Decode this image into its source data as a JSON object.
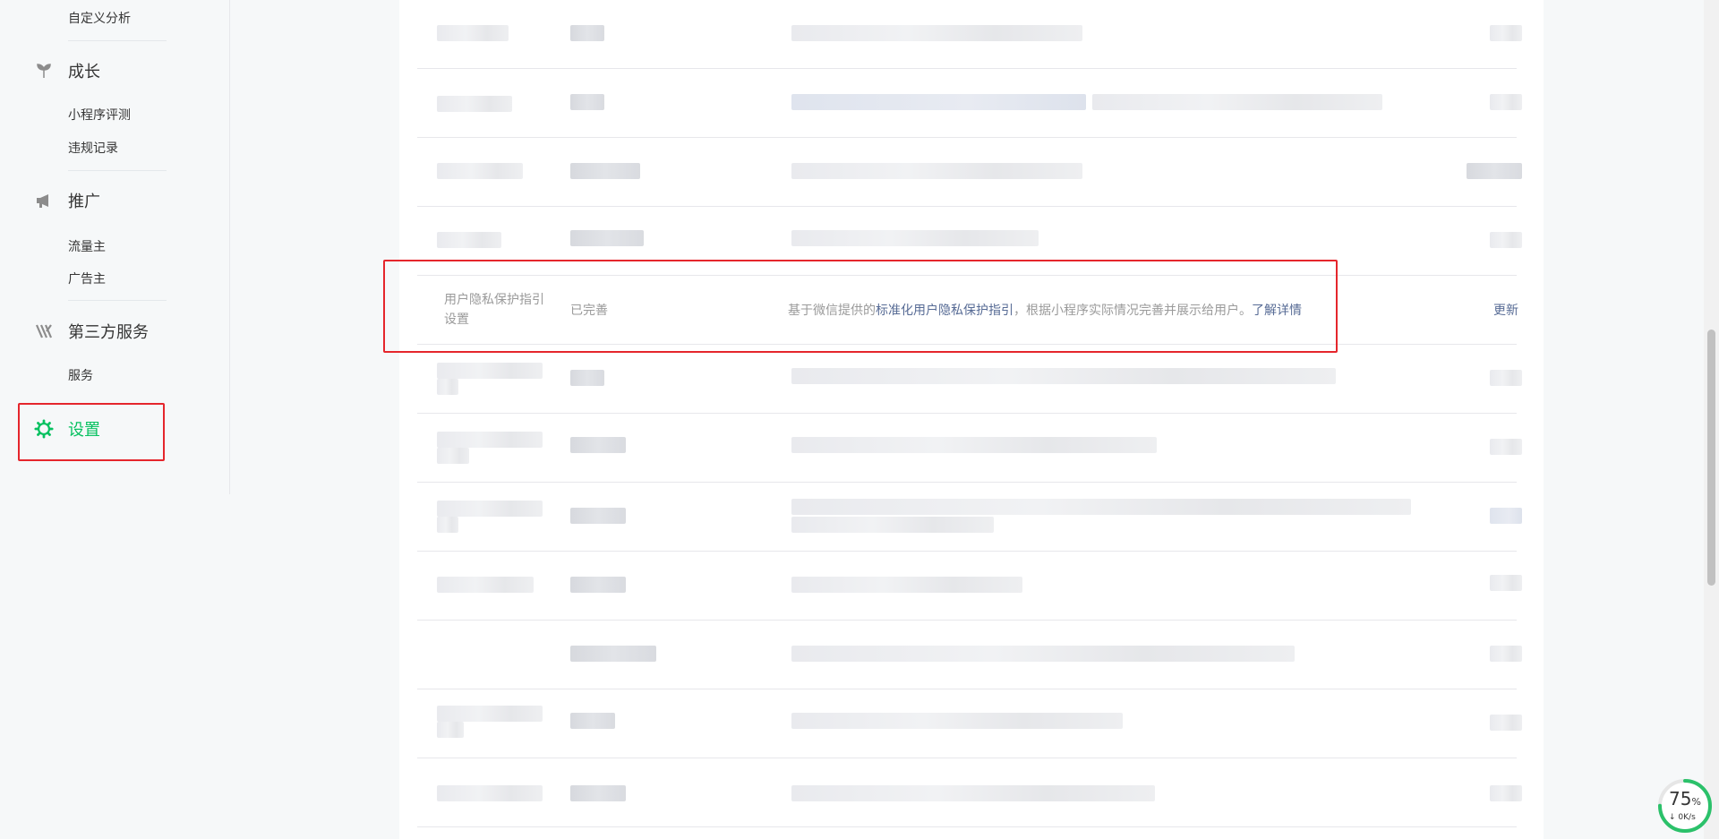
{
  "sidebar": {
    "top_item": "自定义分析",
    "growth": {
      "title": "成长",
      "items": [
        "小程序评测",
        "违规记录"
      ]
    },
    "promotion": {
      "title": "推广",
      "items": [
        "流量主",
        "广告主"
      ]
    },
    "third_party": {
      "title": "第三方服务",
      "items": [
        "服务"
      ]
    },
    "settings": {
      "title": "设置"
    }
  },
  "colors": {
    "accent": "#07c160",
    "link": "#576b95",
    "highlight": "#e5262c"
  },
  "privacy_row": {
    "label": "用户隐私保护指引设置",
    "status": "已完善",
    "desc_prefix": "基于微信提供的",
    "desc_link": "标准化用户隐私保护指引",
    "desc_middle": "，根据小程序实际情况完善并展示给用户。",
    "desc_more": "了解详情",
    "action": "更新"
  },
  "speed_widget": {
    "percent": "75",
    "percent_sign": "%",
    "rate": "0K/s"
  }
}
